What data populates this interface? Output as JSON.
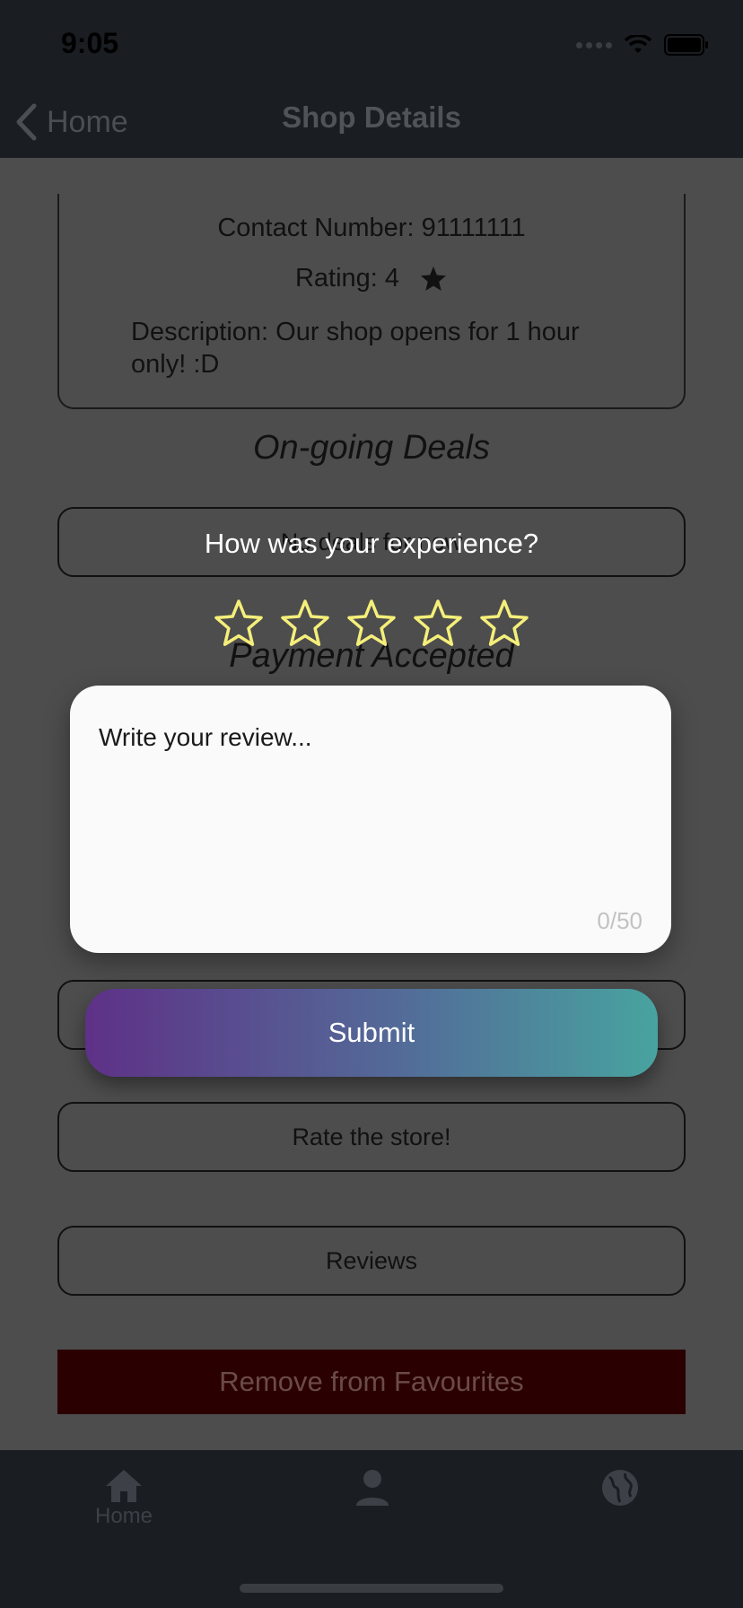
{
  "status_bar": {
    "time": "9:05"
  },
  "nav": {
    "back_label": "Home",
    "title": "Shop Details"
  },
  "shop": {
    "contact": "Contact Number: 91111111",
    "rating": "Rating: 4",
    "description": "Description: Our shop opens for 1 hour only! :D"
  },
  "sections": {
    "deals_title": "On-going Deals",
    "deals_empty": "No deals for now",
    "payment_title": "Payment Accepted"
  },
  "buttons": {
    "rate_store": "Rate the store!",
    "reviews": "Reviews",
    "remove_favourites": "Remove from Favourites"
  },
  "review_dialog": {
    "title": "How was your experience?",
    "stars_selected": 0,
    "stars_total": 5,
    "placeholder": "Write your review...",
    "counter": "0/50",
    "submit_label": "Submit"
  },
  "tab_bar": {
    "tabs": [
      {
        "label": "Home",
        "icon": "home-icon",
        "active": true
      },
      {
        "label": "",
        "icon": "person-icon",
        "active": false
      },
      {
        "label": "",
        "icon": "globe-icon",
        "active": false
      }
    ]
  },
  "colors": {
    "star_outline": "#f5ef7a",
    "submit_gradient_start": "#5e3187",
    "submit_gradient_end": "#48a39f",
    "remove_button_bg": "#2b0000"
  }
}
